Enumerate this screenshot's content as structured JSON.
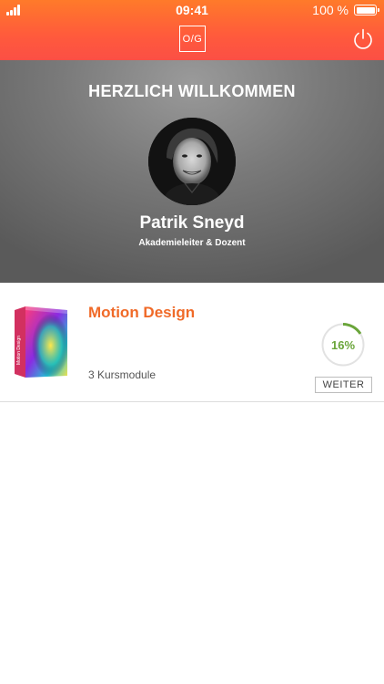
{
  "status_bar": {
    "time": "09:41",
    "battery_percent": "100 %",
    "battery_level": 1.0
  },
  "header": {
    "logo_text": "O/G",
    "icons": {
      "power": "power-icon"
    }
  },
  "hero": {
    "welcome": "HERZLICH WILLKOMMEN",
    "name": "Patrik Sneyd",
    "role": "Akademieleiter & Dozent"
  },
  "courses": [
    {
      "title": "Motion Design",
      "modules": "3 Kursmodule",
      "progress_label": "16%",
      "progress_fraction": 0.16,
      "button_label": "WEITER",
      "cover_text": "Motion Design"
    }
  ],
  "colors": {
    "accent_orange": "#f06a28",
    "header_top": "#ff7a2a",
    "header_bottom": "#fb4f45",
    "progress_green": "#6aa53a"
  }
}
